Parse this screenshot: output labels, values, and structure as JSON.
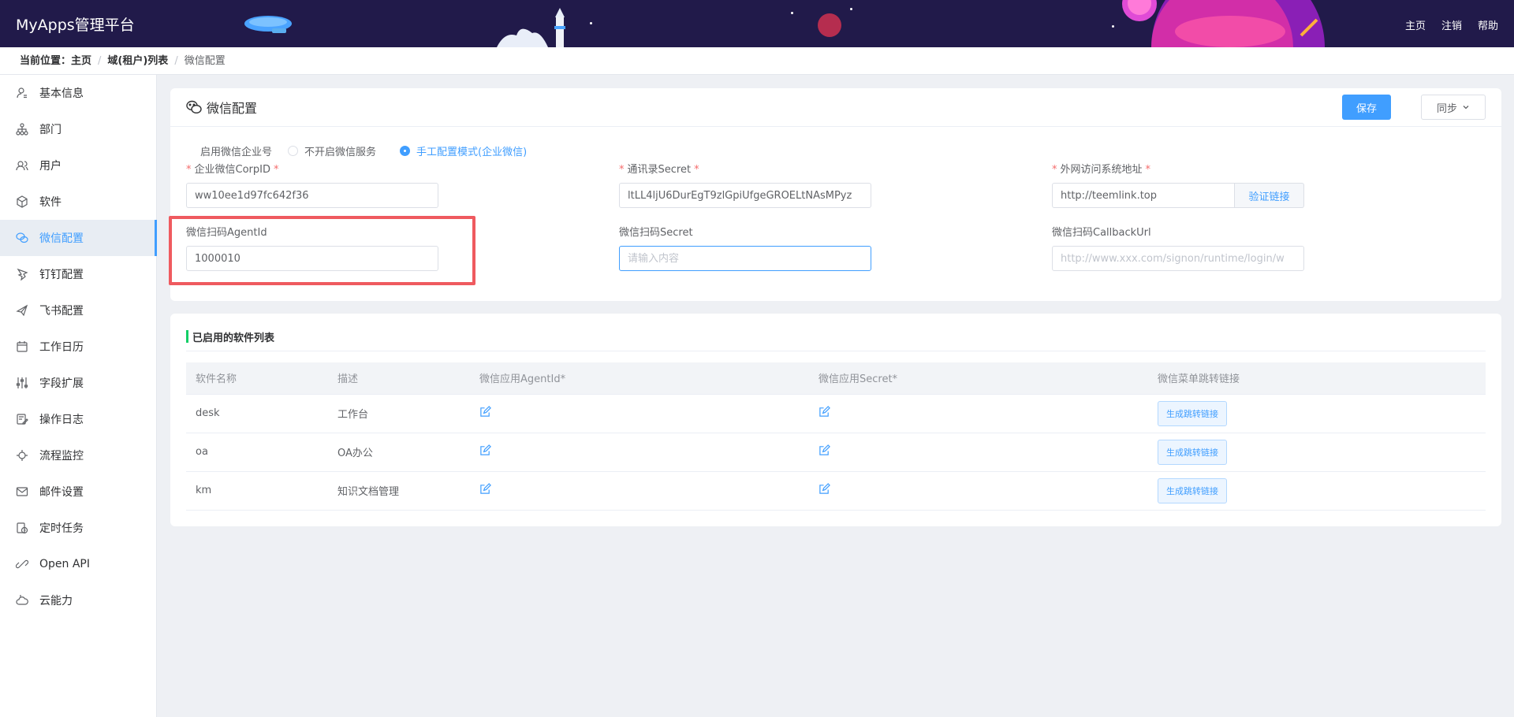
{
  "header": {
    "title": "MyApps管理平台",
    "nav": [
      "主页",
      "注销",
      "帮助"
    ]
  },
  "breadcrumb": {
    "label": "当前位置：",
    "items": [
      "主页",
      "域(租户)列表"
    ],
    "current": "微信配置"
  },
  "sidebar": {
    "items": [
      {
        "label": "基本信息",
        "icon": "user-info-icon"
      },
      {
        "label": "部门",
        "icon": "org-tree-icon"
      },
      {
        "label": "用户",
        "icon": "users-icon"
      },
      {
        "label": "软件",
        "icon": "cube-icon"
      },
      {
        "label": "微信配置",
        "icon": "wechat-icon",
        "active": true
      },
      {
        "label": "钉钉配置",
        "icon": "dingtalk-icon"
      },
      {
        "label": "飞书配置",
        "icon": "feishu-icon"
      },
      {
        "label": "工作日历",
        "icon": "calendar-icon"
      },
      {
        "label": "字段扩展",
        "icon": "sliders-icon"
      },
      {
        "label": "操作日志",
        "icon": "log-icon"
      },
      {
        "label": "流程监控",
        "icon": "monitor-icon"
      },
      {
        "label": "邮件设置",
        "icon": "mail-icon"
      },
      {
        "label": "定时任务",
        "icon": "timer-icon"
      },
      {
        "label": "Open API",
        "icon": "api-icon"
      },
      {
        "label": "云能力",
        "icon": "cloud-icon"
      }
    ]
  },
  "config": {
    "title": "微信配置",
    "save_label": "保存",
    "sync_label": "同步",
    "enable_label": "启用微信企业号",
    "radio_off": "不开启微信服务",
    "radio_manual": "手工配置模式(企业微信)",
    "corpid_label": "企业微信CorpID",
    "corpid_value": "ww10ee1d97fc642f36",
    "contact_secret_label": "通讯录Secret",
    "contact_secret_value": "ltLL4ljU6DurEgT9zlGpiUfgeGROELtNAsMPyz",
    "external_url_label": "外网访问系统地址",
    "external_url_value": "http://teemlink.top",
    "verify_label": "验证链接",
    "agentid_label": "微信扫码AgentId",
    "agentid_value": "1000010",
    "scan_secret_label": "微信扫码Secret",
    "scan_secret_placeholder": "请输入内容",
    "callback_label": "微信扫码CallbackUrl",
    "callback_placeholder": "http://www.xxx.com/signon/runtime/login/w"
  },
  "software_table": {
    "title": "已启用的软件列表",
    "columns": [
      "软件名称",
      "描述",
      "微信应用AgentId*",
      "微信应用Secret*",
      "微信菜单跳转链接"
    ],
    "rows": [
      {
        "name": "desk",
        "desc": "工作台",
        "button": "生成跳转链接"
      },
      {
        "name": "oa",
        "desc": "OA办公",
        "button": "生成跳转链接"
      },
      {
        "name": "km",
        "desc": "知识文档管理",
        "button": "生成跳转链接"
      }
    ]
  }
}
